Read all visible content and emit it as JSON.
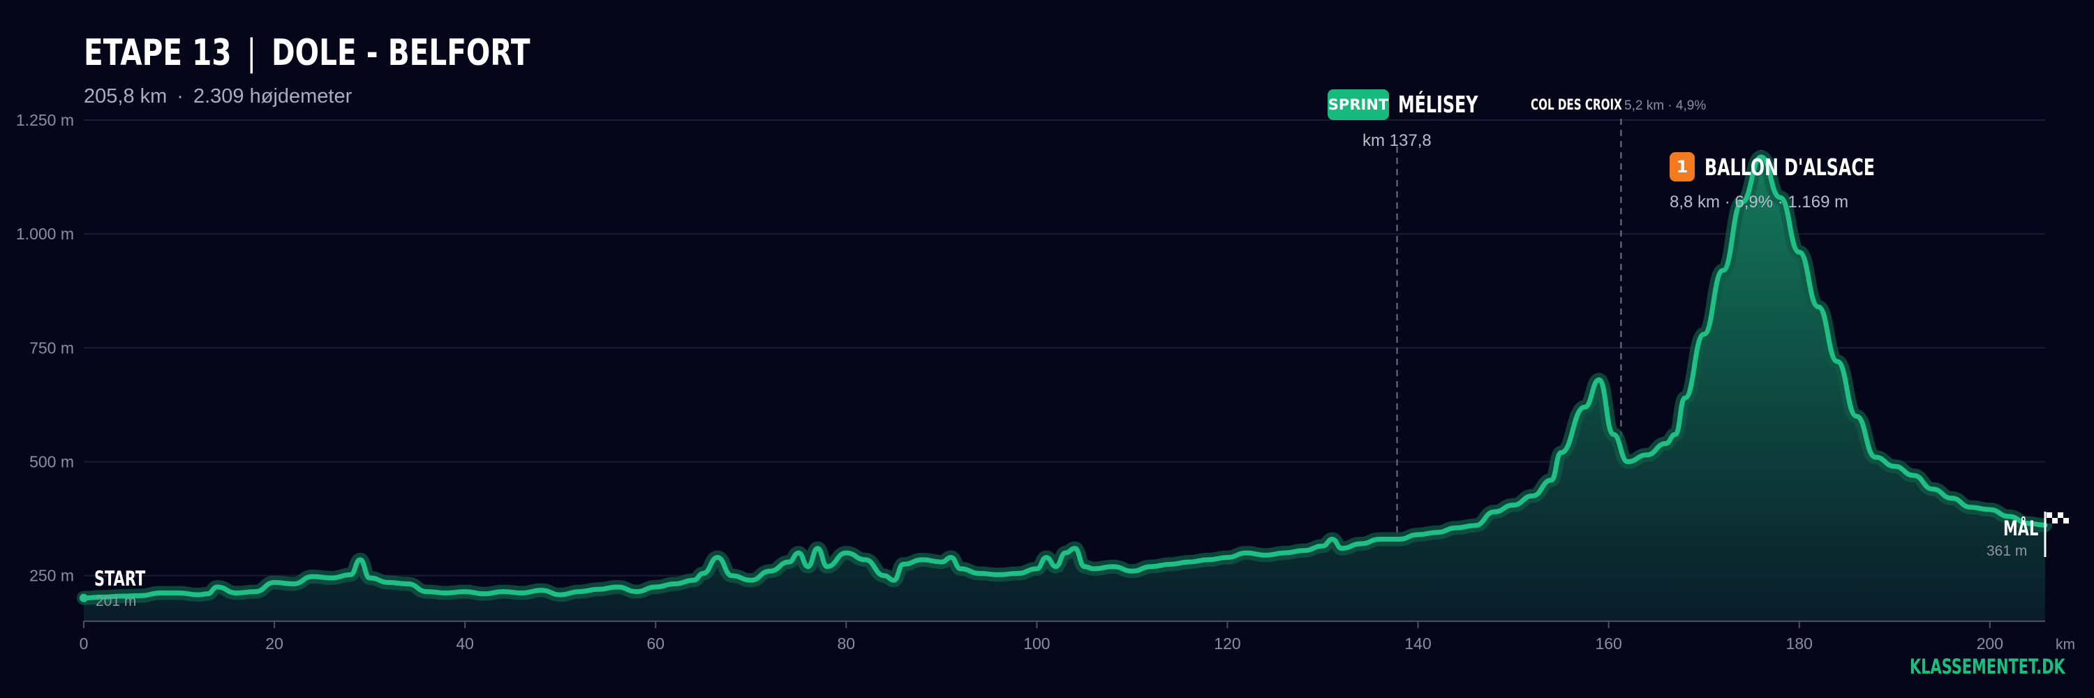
{
  "header": {
    "stage": "ETAPE 13",
    "separator": "|",
    "route": "DOLE - BELFORT",
    "distance": "205,8 km",
    "dot": "·",
    "elevation": "2.309 højdemeter"
  },
  "brand": "KLASSEMENTET.DK",
  "markers": {
    "sprint": {
      "badge": "SPRINT",
      "name": "MÉLISEY",
      "info": "km 137,8",
      "km": 137.8
    },
    "col": {
      "name": "COL DES CROIX",
      "info": "5,2 km · 4,9%",
      "km": 161.3
    },
    "climb": {
      "badge": "1",
      "name": "BALLON D'ALSACE",
      "info": "8,8 km · 6,9% · 1.169 m",
      "km": 176
    }
  },
  "start": {
    "label": "START",
    "elevation": "201 m"
  },
  "finish": {
    "label": "MÅL",
    "elevation": "361 m"
  },
  "colors": {
    "background": "#05061a",
    "profile_line": "#1fbf85",
    "profile_glow": "#0f5a45",
    "sprint_badge": "#17b97d",
    "climb_badge": "#f47a1f"
  },
  "chart_data": {
    "type": "area",
    "xlabel": "km",
    "xlim": [
      0,
      205.8
    ],
    "ylim": [
      150,
      1250
    ],
    "x_ticks": [
      0,
      20,
      40,
      60,
      80,
      100,
      120,
      140,
      160,
      180,
      200
    ],
    "y_ticks": [
      250,
      500,
      750,
      1000,
      1250
    ],
    "y_tick_labels": [
      "250 m",
      "500 m",
      "750 m",
      "1.000 m",
      "1.250 m"
    ],
    "grid": true,
    "series": [
      {
        "x": [
          0,
          2,
          4,
          6,
          8,
          10,
          12,
          13,
          14,
          16,
          18,
          20,
          22,
          24,
          26,
          28,
          29,
          30,
          32,
          34,
          36,
          38,
          40,
          42,
          44,
          46,
          48,
          50,
          52,
          54,
          56,
          58,
          60,
          62,
          64,
          65,
          66.5,
          68,
          70,
          72,
          74,
          75,
          76,
          77,
          78,
          80,
          82,
          84,
          85,
          86,
          88,
          90,
          91,
          92,
          94,
          96,
          98,
          100,
          101,
          102,
          103,
          104,
          105,
          106,
          108,
          110,
          112,
          114,
          116,
          118,
          120,
          122,
          124,
          126,
          128,
          130,
          131,
          132,
          134,
          136,
          138,
          140,
          142,
          144,
          146,
          148,
          150,
          152,
          154,
          155,
          157.5,
          159,
          160.5,
          162,
          164,
          166,
          167,
          168,
          170,
          172,
          174,
          176,
          178,
          180,
          182,
          184,
          186,
          188,
          190,
          192,
          194,
          196,
          198,
          200,
          202,
          204,
          205.8
        ],
        "y": [
          201,
          203,
          205,
          206,
          212,
          212,
          208,
          210,
          225,
          212,
          215,
          235,
          232,
          248,
          245,
          252,
          285,
          245,
          235,
          232,
          215,
          212,
          215,
          210,
          215,
          212,
          218,
          208,
          215,
          220,
          225,
          215,
          225,
          232,
          240,
          255,
          290,
          250,
          240,
          260,
          280,
          300,
          270,
          310,
          270,
          300,
          285,
          250,
          240,
          275,
          285,
          280,
          290,
          265,
          255,
          252,
          255,
          265,
          290,
          270,
          300,
          310,
          270,
          265,
          270,
          260,
          270,
          275,
          280,
          285,
          290,
          300,
          295,
          300,
          305,
          315,
          330,
          310,
          320,
          330,
          330,
          340,
          345,
          355,
          360,
          390,
          405,
          425,
          460,
          520,
          620,
          680,
          560,
          500,
          515,
          540,
          560,
          640,
          780,
          920,
          1070,
          1169,
          1080,
          960,
          840,
          720,
          600,
          510,
          490,
          470,
          440,
          420,
          400,
          395,
          380,
          365,
          361
        ]
      }
    ]
  }
}
